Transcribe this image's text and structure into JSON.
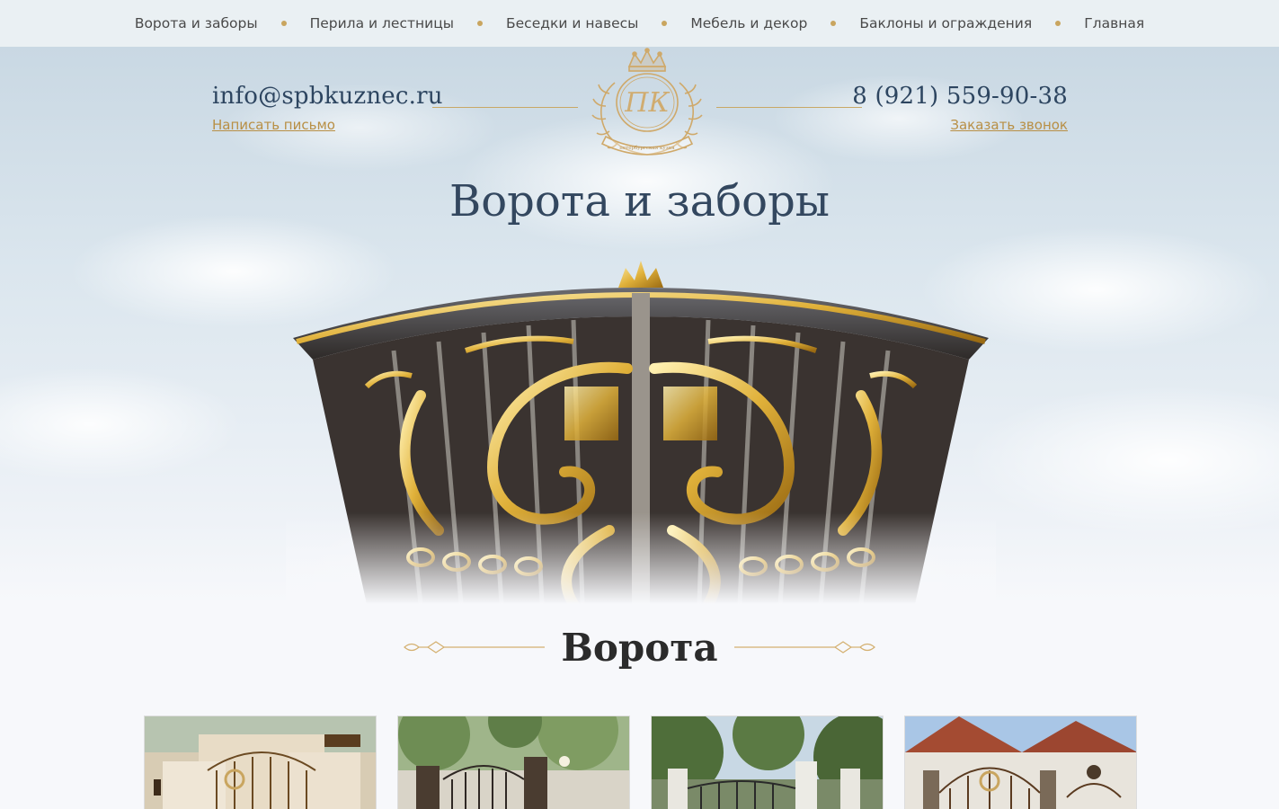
{
  "nav": {
    "items": [
      {
        "label": "Ворота и заборы"
      },
      {
        "label": "Перила и лестницы"
      },
      {
        "label": "Беседки и навесы"
      },
      {
        "label": "Мебель и декор"
      },
      {
        "label": "Баклоны и ограждения"
      },
      {
        "label": "Главная"
      }
    ]
  },
  "header": {
    "email": "info@spbkuznec.ru",
    "email_link": "Написать письмо",
    "phone": "8 (921) 559-90-38",
    "phone_link": "Заказать звонок",
    "logo_monogram": "ПК",
    "logo_ribbon": "петербургская кузня"
  },
  "hero": {
    "title": "Ворота и заборы"
  },
  "section": {
    "title": "Ворота"
  },
  "colors": {
    "gold": "#c9a55f",
    "title_blue": "#33475f",
    "link_gold": "#b88f45"
  },
  "cards": [
    {
      "name": "gate-photo-1"
    },
    {
      "name": "gate-photo-2"
    },
    {
      "name": "gate-photo-3"
    },
    {
      "name": "gate-photo-4"
    }
  ]
}
